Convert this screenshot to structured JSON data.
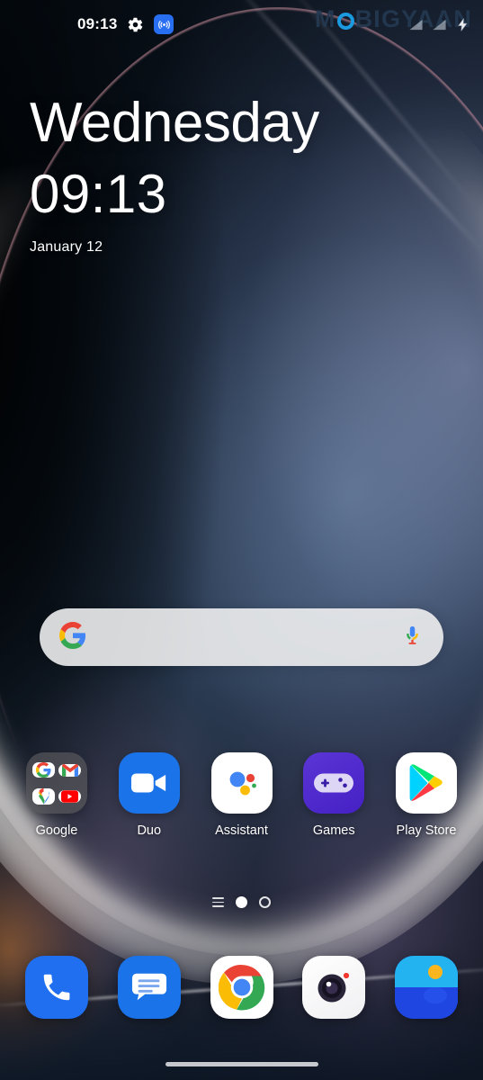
{
  "statusbar": {
    "clock": "09:13",
    "icons_left": [
      "gear-icon",
      "hotspot-icon"
    ],
    "icons_right": [
      "signal-icon",
      "wifi-icon",
      "charging-bolt-icon"
    ]
  },
  "watermark": {
    "before": "M",
    "o": "O",
    "after": "BIGYAAN",
    "accent_color": "#1b9ae0"
  },
  "clock_widget": {
    "day": "Wednesday",
    "time": "09:13",
    "date": "January 12"
  },
  "search": {
    "placeholder": "",
    "value": "",
    "left_icon": "google-g-icon",
    "right_icon": "microphone-icon"
  },
  "app_grid": [
    {
      "label": "Google",
      "icon": "google-folder-icon",
      "type": "folder",
      "folder_items": [
        "google-g-icon",
        "gmail-icon",
        "maps-icon",
        "youtube-icon"
      ]
    },
    {
      "label": "Duo",
      "icon": "duo-video-icon",
      "type": "app",
      "bg": "#1a73e8"
    },
    {
      "label": "Assistant",
      "icon": "assistant-icon",
      "type": "app",
      "bg": "#ffffff"
    },
    {
      "label": "Games",
      "icon": "gamepad-icon",
      "type": "app",
      "bg": "#4b26c9"
    },
    {
      "label": "Play Store",
      "icon": "play-store-icon",
      "type": "app",
      "bg": "#ffffff"
    }
  ],
  "page_indicator": {
    "menu_icon": "lines-icon",
    "pages": 2,
    "active_page": 1
  },
  "dock": [
    {
      "label": "Phone",
      "icon": "phone-icon",
      "bg": "#1f6ff0"
    },
    {
      "label": "Messages",
      "icon": "messages-icon",
      "bg": "#1a73e8"
    },
    {
      "label": "Chrome",
      "icon": "chrome-icon",
      "bg": "#ffffff"
    },
    {
      "label": "Camera",
      "icon": "camera-icon",
      "bg": "#ffffff"
    },
    {
      "label": "Gallery",
      "icon": "gallery-icon",
      "bg": "#1c53e8"
    }
  ],
  "navigation": {
    "type": "gesture-pill"
  },
  "colors": {
    "accent_blue": "#276ef1",
    "google_blue": "#4285f4",
    "google_red": "#ea4335",
    "google_yellow": "#fbbc05",
    "google_green": "#34a853",
    "games_purple": "#4b26c9"
  }
}
